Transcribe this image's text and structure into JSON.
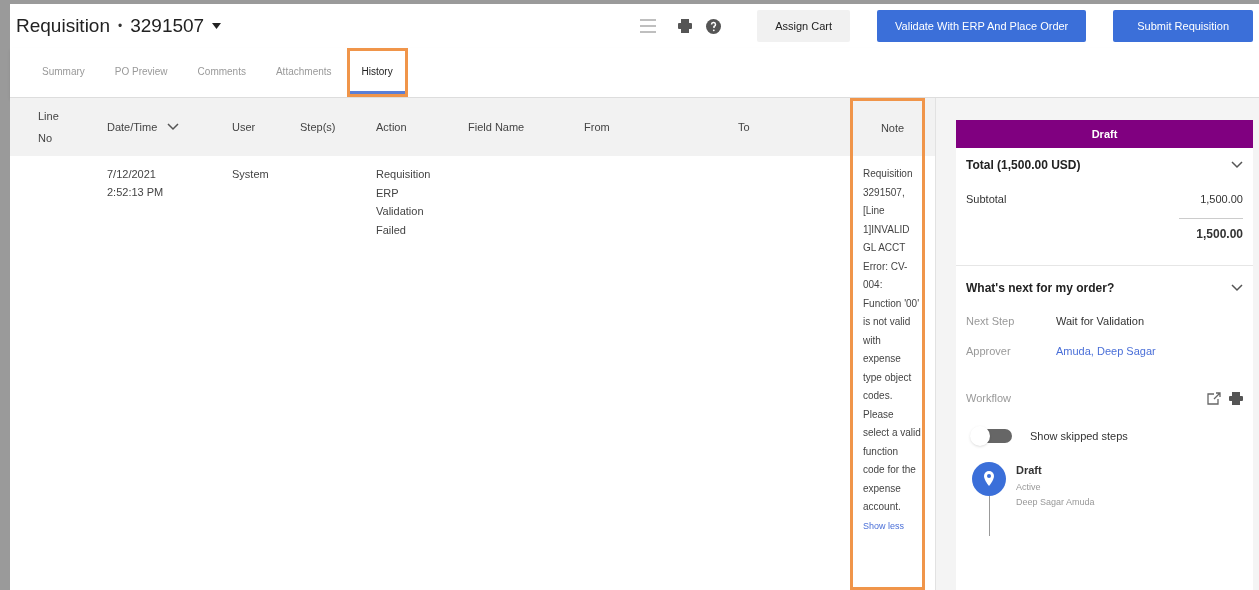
{
  "header": {
    "title": "Requisition",
    "separator": "•",
    "number": "3291507",
    "buttons": [
      {
        "label": "Assign Cart",
        "kind": "secondary"
      },
      {
        "label": "Validate With ERP And Place Order",
        "kind": "primary"
      },
      {
        "label": "Submit Requisition",
        "kind": "primary"
      }
    ]
  },
  "tabs": [
    {
      "label": "Summary",
      "selected": false,
      "highlighted": false
    },
    {
      "label": "PO Preview",
      "selected": false,
      "highlighted": false
    },
    {
      "label": "Comments",
      "selected": false,
      "highlighted": false
    },
    {
      "label": "Attachments",
      "selected": false,
      "highlighted": false
    },
    {
      "label": "History",
      "selected": true,
      "highlighted": true
    }
  ],
  "table": {
    "columns": [
      {
        "label": "Line No",
        "sortable": false
      },
      {
        "label": "Date/Time",
        "sortable": true
      },
      {
        "label": "User",
        "sortable": false
      },
      {
        "label": "Step(s)",
        "sortable": false
      },
      {
        "label": "Action",
        "sortable": false
      },
      {
        "label": "Field Name",
        "sortable": false
      },
      {
        "label": "From",
        "sortable": false
      },
      {
        "label": "To",
        "sortable": false
      },
      {
        "label": "Note",
        "sortable": false
      }
    ],
    "rows": [
      {
        "date_time": "7/12/2021 2:52:13 PM",
        "user": "System",
        "action": "Requisition ERP Validation Failed",
        "note": "Requisition 3291507, [Line 1]INVALID GL ACCT Error: CV-004: Function '00' is not valid with expense type object codes. Please select a valid function code for the expense account.",
        "note_link": "Show less"
      }
    ],
    "note_highlighted": true
  },
  "summary": {
    "status": "Draft",
    "total_label": "Total (1,500.00 USD)",
    "subtotal_label": "Subtotal",
    "subtotal": "1,500.00",
    "total": "1,500.00",
    "next": {
      "title": "What's next for my order?",
      "next_step_label": "Next Step",
      "next_step": "Wait for Validation",
      "approver_label": "Approver",
      "approver": "Amuda, Deep Sagar",
      "workflow_label": "Workflow",
      "toggle_label": "Show skipped steps",
      "show_skipped": false,
      "steps": [
        {
          "name": "Draft",
          "state": "Active",
          "person": "Deep Sagar Amuda"
        }
      ]
    }
  }
}
